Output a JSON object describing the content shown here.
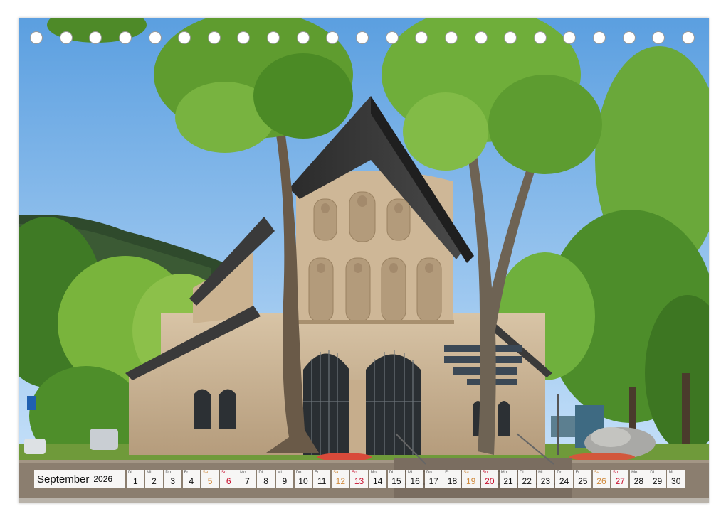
{
  "calendar": {
    "month": "September",
    "year": "2026",
    "days": [
      {
        "n": "1",
        "wd": "Di",
        "type": "week"
      },
      {
        "n": "2",
        "wd": "Mi",
        "type": "week"
      },
      {
        "n": "3",
        "wd": "Do",
        "type": "week"
      },
      {
        "n": "4",
        "wd": "Fr",
        "type": "week"
      },
      {
        "n": "5",
        "wd": "Sa",
        "type": "sat"
      },
      {
        "n": "6",
        "wd": "So",
        "type": "sun"
      },
      {
        "n": "7",
        "wd": "Mo",
        "type": "week"
      },
      {
        "n": "8",
        "wd": "Di",
        "type": "week"
      },
      {
        "n": "9",
        "wd": "Mi",
        "type": "week"
      },
      {
        "n": "10",
        "wd": "Do",
        "type": "week"
      },
      {
        "n": "11",
        "wd": "Fr",
        "type": "week"
      },
      {
        "n": "12",
        "wd": "Sa",
        "type": "sat"
      },
      {
        "n": "13",
        "wd": "So",
        "type": "sun"
      },
      {
        "n": "14",
        "wd": "Mo",
        "type": "week"
      },
      {
        "n": "15",
        "wd": "Di",
        "type": "week"
      },
      {
        "n": "16",
        "wd": "Mi",
        "type": "week"
      },
      {
        "n": "17",
        "wd": "Do",
        "type": "week"
      },
      {
        "n": "18",
        "wd": "Fr",
        "type": "week"
      },
      {
        "n": "19",
        "wd": "Sa",
        "type": "sat"
      },
      {
        "n": "20",
        "wd": "So",
        "type": "sun"
      },
      {
        "n": "21",
        "wd": "Mo",
        "type": "week"
      },
      {
        "n": "22",
        "wd": "Di",
        "type": "week"
      },
      {
        "n": "23",
        "wd": "Mi",
        "type": "week"
      },
      {
        "n": "24",
        "wd": "Do",
        "type": "week"
      },
      {
        "n": "25",
        "wd": "Fr",
        "type": "week"
      },
      {
        "n": "26",
        "wd": "Sa",
        "type": "sat"
      },
      {
        "n": "27",
        "wd": "So",
        "type": "sun"
      },
      {
        "n": "28",
        "wd": "Mo",
        "type": "week"
      },
      {
        "n": "29",
        "wd": "Di",
        "type": "week"
      },
      {
        "n": "30",
        "wd": "Mi",
        "type": "week"
      }
    ]
  },
  "binding": {
    "hole_count": 23
  },
  "colors": {
    "saturday": "#d08a3c",
    "sunday": "#c8102e",
    "sky_top": "#5b9fe0",
    "sky_bottom": "#cfe6fb",
    "foliage": "#5e9a2e",
    "stone": "#c9b394",
    "roof": "#3a3a3a"
  }
}
